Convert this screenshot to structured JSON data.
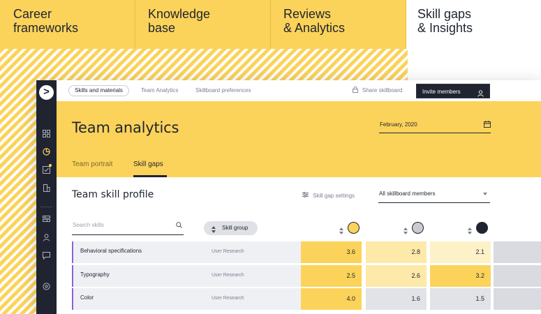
{
  "top_tabs": [
    {
      "line1": "Career",
      "line2": "frameworks",
      "active": false
    },
    {
      "line1": "Knowledge",
      "line2": "base",
      "active": false
    },
    {
      "line1": "Reviews",
      "line2": "& Analytics",
      "active": false
    },
    {
      "line1": "Skill gaps",
      "line2": "& Insights",
      "active": true
    }
  ],
  "colors": {
    "brand_yellow": "#fcd35a",
    "dark": "#1f2430",
    "accent_purple": "#8a63d2",
    "cell_strong": "#fcd35a",
    "cell_light": "#fde9a8",
    "cell_gray": "#e2e3e7"
  },
  "sidebar": {
    "logo_glyph": ">",
    "icons": [
      "grid-icon",
      "chart-icon",
      "checklist-icon",
      "building-icon",
      "roadmap-icon",
      "user-icon",
      "chat-icon",
      "settings-icon"
    ]
  },
  "topbar": {
    "nav": [
      "Skills and materials",
      "Team Analytics",
      "Skillboard preferences"
    ],
    "share_label": "Share skillboard",
    "invite_label": "Invite members"
  },
  "header": {
    "title": "Team analytics",
    "date": "February, 2020",
    "tabs": [
      "Team portrait",
      "Skill gaps"
    ],
    "active_tab": "Skill gaps"
  },
  "profile": {
    "title": "Team skill profile",
    "gap_settings_label": "Skill gap settings",
    "members_select": "All skillboard members",
    "search_placeholder": "Search skills",
    "group_button": "Skill group",
    "members": [
      {
        "avatar_color": "#fcd35a"
      },
      {
        "avatar_color": "#c9cbd0"
      },
      {
        "avatar_color": "#1f2430"
      }
    ],
    "rows": [
      {
        "skill": "Behavioral specifications",
        "group": "User Research",
        "scores": [
          "3.6",
          "2.8",
          "2.1"
        ]
      },
      {
        "skill": "Typography",
        "group": "User Research",
        "scores": [
          "2.5",
          "2.6",
          "3.2"
        ]
      },
      {
        "skill": "Color",
        "group": "User Research",
        "scores": [
          "4.0",
          "1.6",
          "1.5"
        ]
      }
    ]
  }
}
